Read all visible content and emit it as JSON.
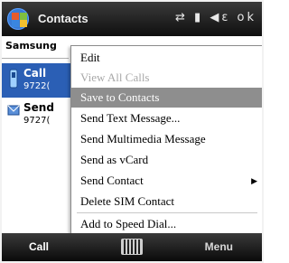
{
  "titlebar": {
    "title": "Contacts",
    "status_icons": [
      "⇄",
      "▮",
      "◀ε",
      "ok"
    ]
  },
  "list": {
    "group": "Samsung",
    "contacts": [
      {
        "name": "Call",
        "number": "9722(",
        "selected": true
      },
      {
        "name": "Send",
        "number": "9727(",
        "selected": false
      }
    ]
  },
  "menu": {
    "items": [
      {
        "label": "Edit",
        "disabled": false
      },
      {
        "label": "View All Calls",
        "disabled": true
      },
      {
        "label": "Save to Contacts",
        "highlighted": true
      },
      {
        "label": "Send Text Message..."
      },
      {
        "label": "Send Multimedia Message"
      },
      {
        "label": "Send as vCard"
      },
      {
        "label": "Send Contact",
        "has_submenu": true
      },
      {
        "label": "Delete SIM Contact"
      },
      {
        "label": "Add to Speed Dial..."
      }
    ]
  },
  "softkeys": {
    "left": "Call",
    "right": "Menu"
  }
}
